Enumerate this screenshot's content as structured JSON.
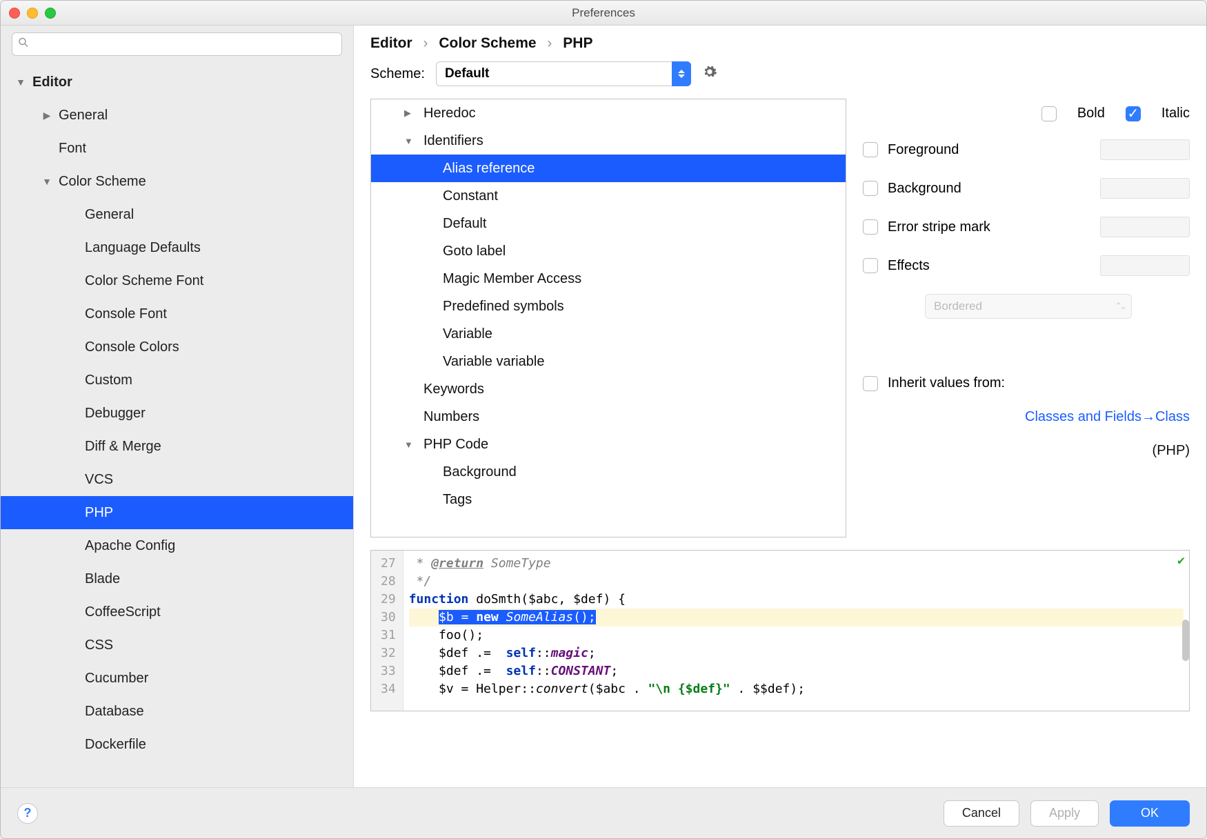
{
  "window": {
    "title": "Preferences"
  },
  "breadcrumb": {
    "a": "Editor",
    "b": "Color Scheme",
    "c": "PHP"
  },
  "scheme": {
    "label": "Scheme:",
    "value": "Default"
  },
  "sidebar": {
    "items": [
      {
        "label": "Editor",
        "bold": true,
        "arrow": "down",
        "indent": 0
      },
      {
        "label": "General",
        "arrow": "right",
        "indent": 1
      },
      {
        "label": "Font",
        "indent": 1
      },
      {
        "label": "Color Scheme",
        "arrow": "down",
        "indent": 1
      },
      {
        "label": "General",
        "indent": 2
      },
      {
        "label": "Language Defaults",
        "indent": 2
      },
      {
        "label": "Color Scheme Font",
        "indent": 2
      },
      {
        "label": "Console Font",
        "indent": 2
      },
      {
        "label": "Console Colors",
        "indent": 2
      },
      {
        "label": "Custom",
        "indent": 2
      },
      {
        "label": "Debugger",
        "indent": 2
      },
      {
        "label": "Diff & Merge",
        "indent": 2
      },
      {
        "label": "VCS",
        "indent": 2
      },
      {
        "label": "PHP",
        "indent": 2,
        "selected": true
      },
      {
        "label": "Apache Config",
        "indent": 2
      },
      {
        "label": "Blade",
        "indent": 2
      },
      {
        "label": "CoffeeScript",
        "indent": 2
      },
      {
        "label": "CSS",
        "indent": 2
      },
      {
        "label": "Cucumber",
        "indent": 2
      },
      {
        "label": "Database",
        "indent": 2
      },
      {
        "label": "Dockerfile",
        "indent": 2
      }
    ]
  },
  "elements": {
    "items": [
      {
        "label": "Heredoc",
        "arrow": "right",
        "indent": 0
      },
      {
        "label": "Identifiers",
        "arrow": "down",
        "indent": 0
      },
      {
        "label": "Alias reference",
        "indent": 1,
        "selected": true
      },
      {
        "label": "Constant",
        "indent": 1
      },
      {
        "label": "Default",
        "indent": 1
      },
      {
        "label": "Goto label",
        "indent": 1
      },
      {
        "label": "Magic Member Access",
        "indent": 1
      },
      {
        "label": "Predefined symbols",
        "indent": 1
      },
      {
        "label": "Variable",
        "indent": 1
      },
      {
        "label": "Variable variable",
        "indent": 1
      },
      {
        "label": "Keywords",
        "indent": 0
      },
      {
        "label": "Numbers",
        "indent": 0
      },
      {
        "label": "PHP Code",
        "arrow": "down",
        "indent": 0
      },
      {
        "label": "Background",
        "indent": 1
      },
      {
        "label": "Tags",
        "indent": 1
      }
    ]
  },
  "props": {
    "bold": "Bold",
    "italic": "Italic",
    "foreground": "Foreground",
    "background": "Background",
    "errorstripe": "Error stripe mark",
    "effects": "Effects",
    "effects_value": "Bordered",
    "inherit": "Inherit values from:",
    "inherit_link": "Classes and Fields→Class",
    "inherit_sub": "(PHP)"
  },
  "code": {
    "lines": [
      "27",
      "28",
      "29",
      "30",
      "31",
      "32",
      "33",
      "34"
    ],
    "l27_a": " * ",
    "l27_tag": "@return",
    "l27_b": " SomeType",
    "l28": " */",
    "l29_fn": "function",
    "l29_rest": " doSmth($abc, $def) {",
    "l30_a": "$b",
    "l30_b": " = ",
    "l30_new": "new",
    "l30_c": " ",
    "l30_alias": "SomeAlias",
    "l30_d": "();",
    "l31": "    foo();",
    "l32_a": "    $def .=  ",
    "l32_self": "self",
    "l32_b": "::",
    "l32_magic": "magic",
    "l32_c": ";",
    "l33_a": "    $def .=  ",
    "l33_self": "self",
    "l33_b": "::",
    "l33_const": "CONSTANT",
    "l33_c": ";",
    "l34_a": "    $v = Helper::",
    "l34_conv": "convert",
    "l34_b": "($abc . ",
    "l34_str": "\"\\n {$def}\"",
    "l34_c": " . $$def);"
  },
  "footer": {
    "cancel": "Cancel",
    "apply": "Apply",
    "ok": "OK"
  }
}
